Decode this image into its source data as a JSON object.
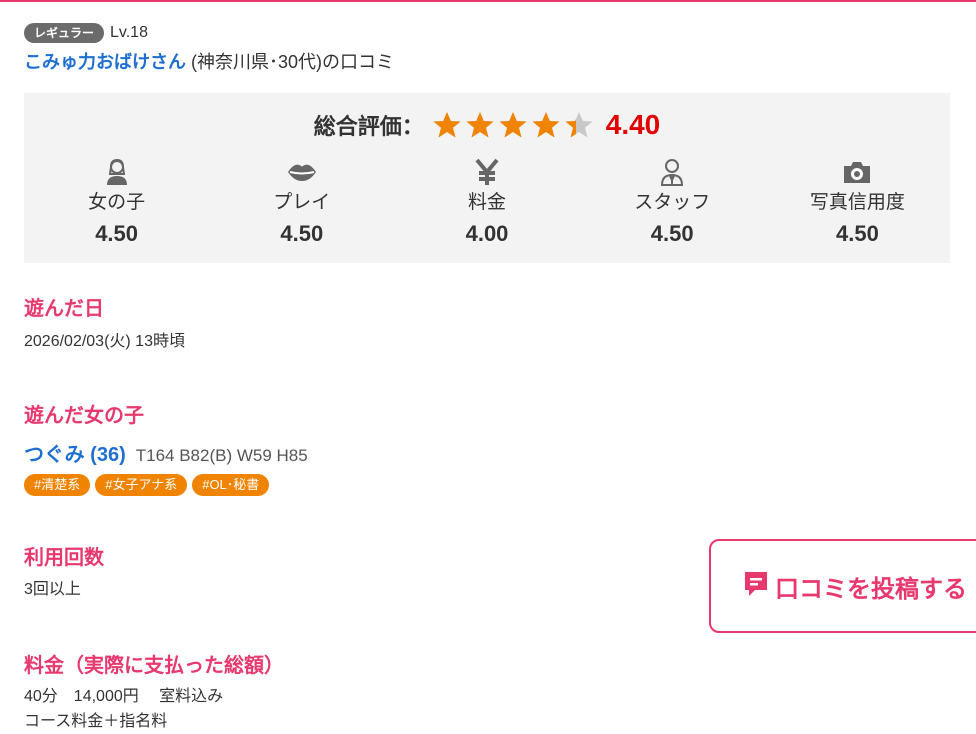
{
  "reviewer": {
    "rank_badge": "レギュラー",
    "level": "Lv.18",
    "name": "こみゅ力おばけさん",
    "meta": "(神奈川県･30代)の口コミ"
  },
  "rating": {
    "overall_label": "総合評価：",
    "overall_score": "4.40",
    "overall_value": 4.4,
    "star_color": "#f08300",
    "categories": [
      {
        "label": "女の子",
        "score": "4.50",
        "icon": "girl-icon"
      },
      {
        "label": "プレイ",
        "score": "4.50",
        "icon": "lips-icon"
      },
      {
        "label": "料金",
        "score": "4.00",
        "icon": "yen-icon"
      },
      {
        "label": "スタッフ",
        "score": "4.50",
        "icon": "staff-icon"
      },
      {
        "label": "写真信用度",
        "score": "4.50",
        "icon": "camera-icon"
      }
    ]
  },
  "sections": {
    "visit_date_title": "遊んだ日",
    "visit_date": "2026/02/03(火) 13時頃",
    "girl_title": "遊んだ女の子",
    "girl_name": "つぐみ (36)",
    "girl_specs": "T164 B82(B) W59 H85",
    "tags": [
      "#清楚系",
      "#女子アナ系",
      "#OL･秘書"
    ],
    "usage_title": "利用回数",
    "usage": "3回以上",
    "price_title": "料金（実際に支払った総額）",
    "price_line1": "40分　14,000円　 室料込み",
    "price_line2": "コース料金＋指名料"
  },
  "post_button": {
    "label": "口コミを投稿する",
    "icon": "comment-icon"
  },
  "colors": {
    "accent": "#e8396f",
    "link": "#1f6fd0",
    "score_red": "#e30000",
    "tag_orange": "#f08300"
  }
}
